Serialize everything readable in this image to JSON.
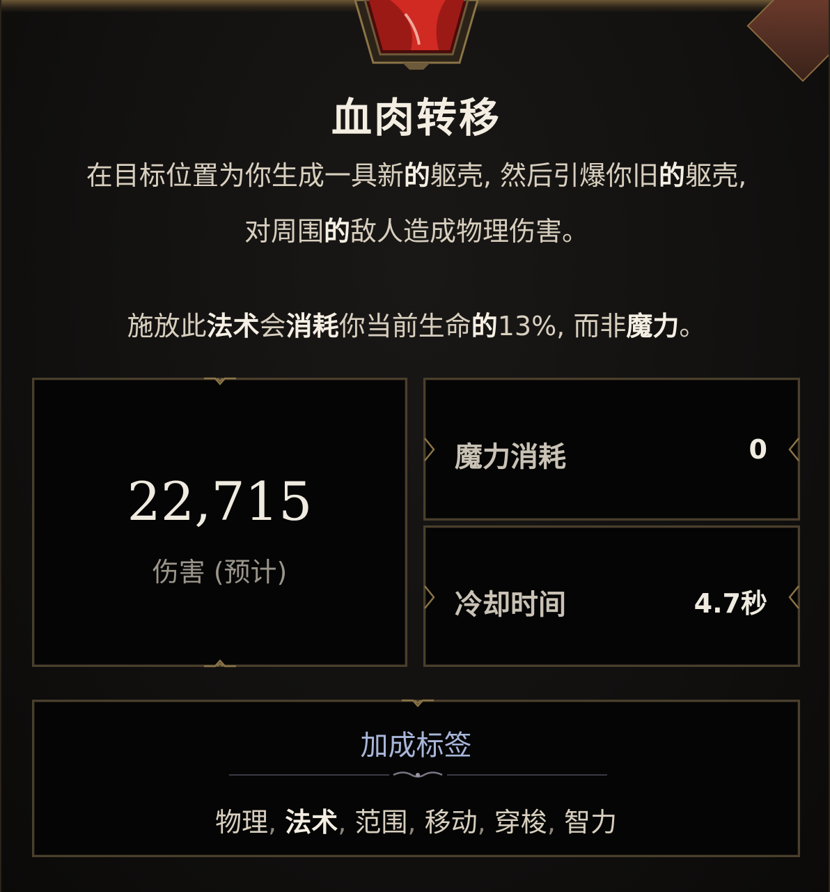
{
  "ability": {
    "title": "血肉转移",
    "description_line1_parts": [
      "在目标位置为你生成一具新",
      "的",
      "躯壳, 然后引爆你旧",
      "的",
      "躯壳,"
    ],
    "description_line2_parts": [
      "对周围",
      "的",
      "敌人造成物理伤害。"
    ],
    "description_line3_parts": [
      "施放此",
      "法术",
      "会",
      "消耗",
      "你当前生命",
      "的",
      "13%, 而非",
      "魔力",
      "。"
    ]
  },
  "stats": {
    "damage_value": "22,715",
    "damage_label": "伤害 (预计)",
    "mana_cost_label": "魔力消耗",
    "mana_cost_value": "0",
    "cooldown_label": "冷却时间",
    "cooldown_value": "4.7秒"
  },
  "tags": {
    "title": "加成标签",
    "items": [
      {
        "label": "物理",
        "strong": false
      },
      {
        "label": "法术",
        "strong": true
      },
      {
        "label": "范围",
        "strong": false
      },
      {
        "label": "移动",
        "strong": false
      },
      {
        "label": "穿梭",
        "strong": false
      },
      {
        "label": "智力",
        "strong": false
      }
    ],
    "separator": ","
  },
  "colors": {
    "frame_gold": "#8b7447",
    "panel_border": "#4a3f2c",
    "tag_title": "#a8b6d9",
    "portrait_red": "#b3201b"
  },
  "icons": {
    "portrait": "ability-portrait-icon",
    "divider": "ornament-divider-icon",
    "notch": "frame-notch-icon"
  }
}
